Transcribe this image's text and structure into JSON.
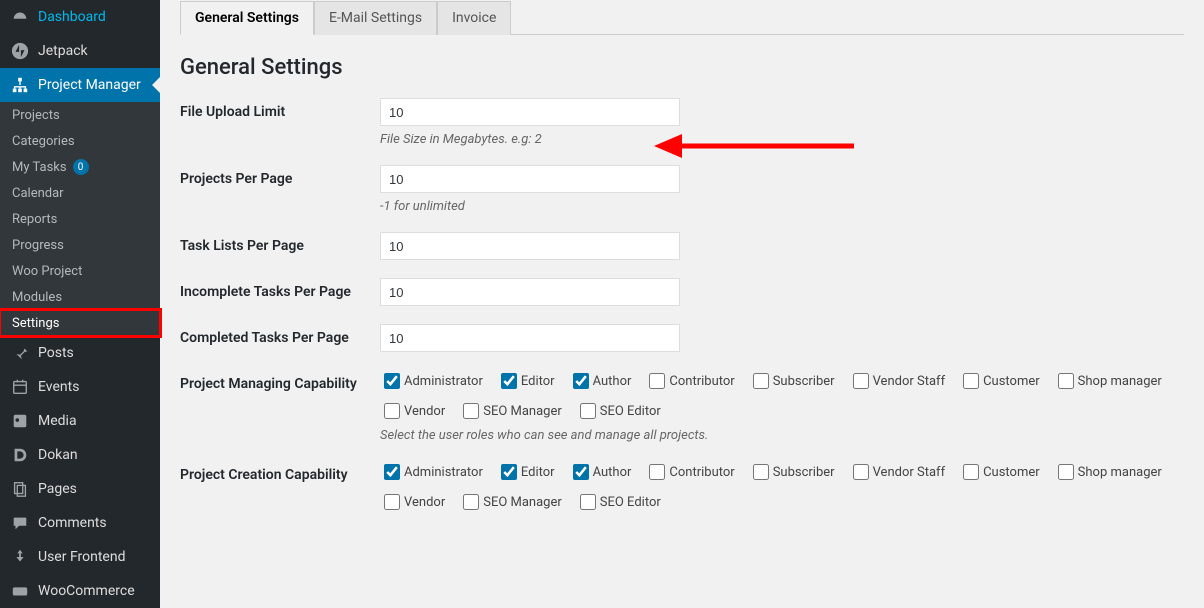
{
  "sidebar": {
    "items": [
      {
        "label": "Dashboard",
        "icon": "dashboard-icon"
      },
      {
        "label": "Jetpack",
        "icon": "jetpack-icon"
      },
      {
        "label": "Project Manager",
        "icon": "sitemap-icon",
        "current": true
      },
      {
        "label": "Posts",
        "icon": "pin-icon"
      },
      {
        "label": "Events",
        "icon": "calendar-icon"
      },
      {
        "label": "Media",
        "icon": "media-icon"
      },
      {
        "label": "Dokan",
        "icon": "dokan-icon"
      },
      {
        "label": "Pages",
        "icon": "pages-icon"
      },
      {
        "label": "Comments",
        "icon": "comments-icon"
      },
      {
        "label": "User Frontend",
        "icon": "userfrontend-icon"
      },
      {
        "label": "WooCommerce",
        "icon": "woo-icon"
      }
    ],
    "submenu": [
      {
        "label": "Projects"
      },
      {
        "label": "Categories"
      },
      {
        "label": "My Tasks",
        "badge": "0"
      },
      {
        "label": "Calendar"
      },
      {
        "label": "Reports"
      },
      {
        "label": "Progress"
      },
      {
        "label": "Woo Project"
      },
      {
        "label": "Modules"
      },
      {
        "label": "Settings",
        "highlighted": true
      }
    ]
  },
  "tabs": [
    {
      "label": "General Settings",
      "active": true
    },
    {
      "label": "E-Mail Settings"
    },
    {
      "label": "Invoice"
    }
  ],
  "heading": "General Settings",
  "fields": {
    "file_upload": {
      "label": "File Upload Limit",
      "value": "10",
      "helper": "File Size in Megabytes. e.g: 2"
    },
    "projects_per_page": {
      "label": "Projects Per Page",
      "value": "10",
      "helper": "-1 for unlimited"
    },
    "task_lists_per_page": {
      "label": "Task Lists Per Page",
      "value": "10"
    },
    "incomplete_tasks_per_page": {
      "label": "Incomplete Tasks Per Page",
      "value": "10"
    },
    "completed_tasks_per_page": {
      "label": "Completed Tasks Per Page",
      "value": "10"
    },
    "project_managing": {
      "label": "Project Managing Capability",
      "helper": "Select the user roles who can see and manage all projects."
    },
    "project_creation": {
      "label": "Project Creation Capability"
    }
  },
  "roles": [
    {
      "label": "Administrator",
      "managing": true,
      "creation": true
    },
    {
      "label": "Editor",
      "managing": true,
      "creation": true
    },
    {
      "label": "Author",
      "managing": true,
      "creation": true
    },
    {
      "label": "Contributor",
      "managing": false,
      "creation": false
    },
    {
      "label": "Subscriber",
      "managing": false,
      "creation": false
    },
    {
      "label": "Vendor Staff",
      "managing": false,
      "creation": false
    },
    {
      "label": "Customer",
      "managing": false,
      "creation": false
    },
    {
      "label": "Shop manager",
      "managing": false,
      "creation": false
    },
    {
      "label": "Vendor",
      "managing": false,
      "creation": false
    },
    {
      "label": "SEO Manager",
      "managing": false,
      "creation": false
    },
    {
      "label": "SEO Editor",
      "managing": false,
      "creation": false
    }
  ]
}
